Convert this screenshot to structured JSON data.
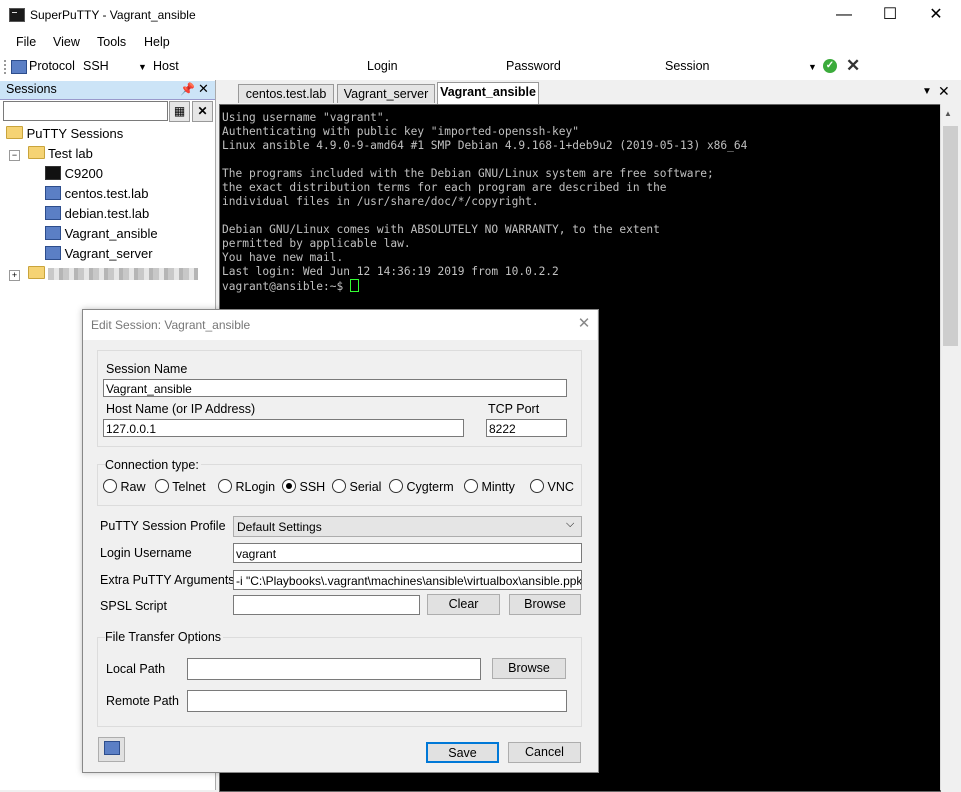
{
  "window": {
    "title": "SuperPuTTY - Vagrant_ansible",
    "minimize": "—",
    "maximize": "☐",
    "close": "✕"
  },
  "menu": [
    "File",
    "View",
    "Tools",
    "Help"
  ],
  "toolbar": {
    "protocol_label": "Protocol",
    "protocol_value": "SSH",
    "host_label": "Host",
    "login_label": "Login",
    "password_label": "Password",
    "session_label": "Session"
  },
  "sessions": {
    "title": "Sessions",
    "root": "PuTTY Sessions",
    "folder": "Test lab",
    "items": [
      "C9200",
      "centos.test.lab",
      "debian.test.lab",
      "Vagrant_ansible",
      "Vagrant_server"
    ]
  },
  "tabs": [
    "centos.test.lab",
    "Vagrant_server",
    "Vagrant_ansible"
  ],
  "terminal": {
    "lines": [
      "Using username \"vagrant\".",
      "Authenticating with public key \"imported-openssh-key\"",
      "Linux ansible 4.9.0-9-amd64 #1 SMP Debian 4.9.168-1+deb9u2 (2019-05-13) x86_64",
      "",
      "The programs included with the Debian GNU/Linux system are free software;",
      "the exact distribution terms for each program are described in the",
      "individual files in /usr/share/doc/*/copyright.",
      "",
      "Debian GNU/Linux comes with ABSOLUTELY NO WARRANTY, to the extent",
      "permitted by applicable law.",
      "You have new mail.",
      "Last login: Wed Jun 12 14:36:19 2019 from 10.0.2.2"
    ],
    "prompt": "vagrant@ansible:~$ "
  },
  "dialog": {
    "title": "Edit Session: Vagrant_ansible",
    "session_name_label": "Session Name",
    "session_name": "Vagrant_ansible",
    "host_label": "Host Name (or IP Address)",
    "host": "127.0.0.1",
    "port_label": "TCP Port",
    "port": "8222",
    "connection_type_label": "Connection type:",
    "connection_types": [
      "Raw",
      "Telnet",
      "RLogin",
      "SSH",
      "Serial",
      "Cygterm",
      "Mintty",
      "VNC"
    ],
    "selected_connection": "SSH",
    "profile_label": "PuTTY Session Profile",
    "profile": "Default Settings",
    "login_label": "Login Username",
    "login": "vagrant",
    "extra_args_label": "Extra PuTTY Arguments",
    "extra_args": "-i \"C:\\Playbooks\\.vagrant\\machines\\ansible\\virtualbox\\ansible.ppk\"",
    "spsl_label": "SPSL Script",
    "spsl": "",
    "clear_button": "Clear",
    "browse_button": "Browse",
    "file_transfer_label": "File Transfer Options",
    "local_path_label": "Local Path",
    "local_path": "",
    "local_browse": "Browse",
    "remote_path_label": "Remote Path",
    "remote_path": "",
    "save_button": "Save",
    "cancel_button": "Cancel"
  }
}
